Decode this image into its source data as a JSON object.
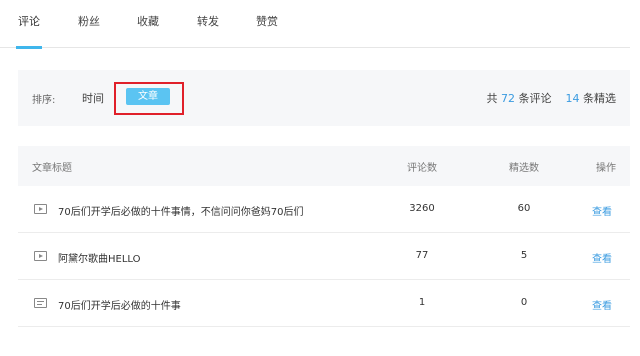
{
  "tabs": [
    "评论",
    "粉丝",
    "收藏",
    "转发",
    "赞赏"
  ],
  "sort": {
    "label": "排序:",
    "option_time": "时间",
    "option_article": "文章"
  },
  "stats": {
    "prefix": "共",
    "comment_count": "72",
    "comment_suffix": "条评论",
    "featured_count": "14",
    "featured_suffix": "条精选"
  },
  "table": {
    "headers": {
      "title": "文章标题",
      "comments": "评论数",
      "featured": "精选数",
      "actions": "操作"
    },
    "rows": [
      {
        "icon": "video-icon",
        "title": "70后们开学后必做的十件事情，不信问问你爸妈70后们",
        "comments": "3260",
        "featured": "60",
        "action": "查看"
      },
      {
        "icon": "video-icon",
        "title": "阿黛尔歌曲HELLO",
        "comments": "77",
        "featured": "5",
        "action": "查看"
      },
      {
        "icon": "article-icon",
        "title": "70后们开学后必做的十件事",
        "comments": "1",
        "featured": "0",
        "action": "查看"
      }
    ]
  },
  "colors": {
    "accent": "#3fb6ec",
    "link": "#3a9be0",
    "highlight_border": "#e0202a"
  }
}
